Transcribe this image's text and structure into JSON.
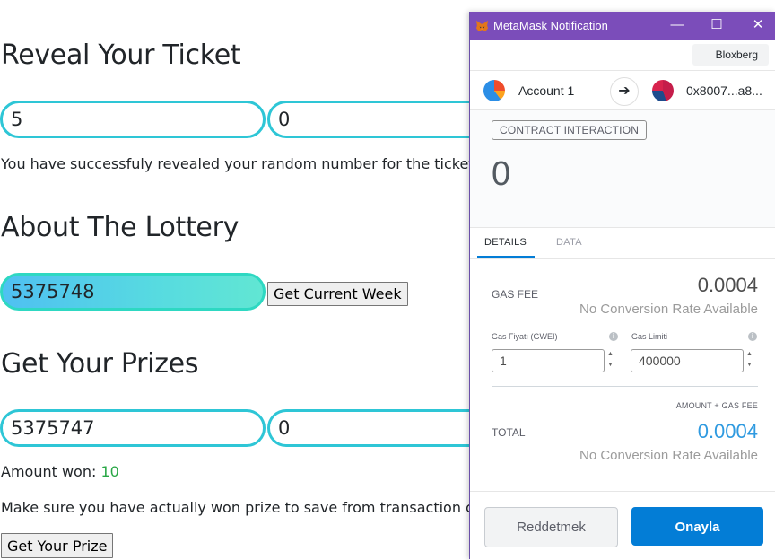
{
  "page": {
    "reveal": {
      "heading": "Reveal Your Ticket",
      "input1_value": "5",
      "input2_value": "0",
      "message": "You have successfuly revealed your random number for the ticket with nur"
    },
    "about": {
      "heading": "About The Lottery",
      "week_value": "5375748",
      "button_label": "Get Current Week"
    },
    "prizes": {
      "heading": "Get Your Prizes",
      "input1_value": "5375747",
      "input2_value": "0",
      "amount_label": "Amount won:",
      "amount_value": "10",
      "note": "Make sure you have actually won prize to save from transaction costs.",
      "button_label": "Get Your Prize"
    }
  },
  "metamask": {
    "window_title": "MetaMask Notification",
    "window_controls": {
      "minimize": "—",
      "maximize": "☐",
      "close": "✕"
    },
    "network": "Bloxberg",
    "from_account": "Account 1",
    "to_address": "0x8007...a8...",
    "tag": "CONTRACT INTERACTION",
    "amount": "0",
    "tabs": [
      "DETAILS",
      "DATA"
    ],
    "gas_fee_label": "GAS FEE",
    "gas_fee_value": "0.0004",
    "no_conversion": "No Conversion Rate Available",
    "gas_price_label": "Gas Fiyatı (GWEI)",
    "gas_price_value": "1",
    "gas_limit_label": "Gas Limiti",
    "gas_limit_value": "400000",
    "amount_gas_label": "AMOUNT + GAS FEE",
    "total_label": "TOTAL",
    "total_value": "0.0004",
    "reject_label": "Reddetmek",
    "confirm_label": "Onayla",
    "colors": {
      "titlebar": "#7b4dba",
      "confirm": "#037dd6",
      "total": "#2f9ae0"
    }
  }
}
